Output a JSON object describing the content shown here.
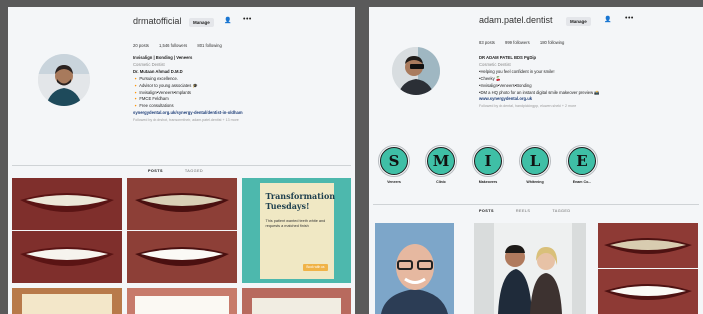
{
  "left_profile": {
    "username": "drmatofficial",
    "manage_button": "Manage",
    "more_button": "•••",
    "stats": {
      "posts": "20 posts",
      "followers": "1,546 followers",
      "following": "801 following"
    },
    "bio": [
      "Invisalign | Bonding | Veneers",
      "Cosmetic Dentist",
      "Dr. Mutaan Ahmad D.M.D",
      "🔸 Pursuing excellence.",
      "🔸 Advisor to young associates 🎓",
      "🔸 Invisalign•Veneers•Implants",
      "🔸 FMCE Feldham",
      "🔸 Free consultations",
      "synergydental.org.uk/synergy-dental/dentist-in-oldham",
      "Followed by dr.drshot, transormtheir, adam.patel.dentist + 13 more"
    ],
    "tabs": [
      "POSTS",
      "TAGGED"
    ],
    "transformation_card": {
      "title": "Transformation Tuesdays!",
      "body": "This patient wanted teeth white and requests a matched finish",
      "button": "Book with us"
    }
  },
  "right_profile": {
    "username": "adam.patel.dentist",
    "manage_button": "Manage",
    "more_button": "•••",
    "stats": {
      "posts": "83 posts",
      "followers": "999 followers",
      "following": "180 following"
    },
    "bio": [
      "DR ADAM PATEL BDS PgDip",
      "Cosmetic Dentist",
      "•Helping you feel confident in your smile!",
      "•Cheeky 🍒",
      "•Invisalign•Veneers•Bonding",
      "•DM a HQ photo for an instant digital smile makeover preview 📸",
      "www.synergydental.org.uk",
      "Followed by dr.dental, handpickingpp, eluwen.sheki + 2 more"
    ],
    "highlights": [
      {
        "letter": "S",
        "label": "Veneers"
      },
      {
        "letter": "M",
        "label": "Clinic"
      },
      {
        "letter": "I",
        "label": "Makeovers"
      },
      {
        "letter": "L",
        "label": "Whitening"
      },
      {
        "letter": "E",
        "label": "Enam Co..."
      }
    ],
    "tabs": [
      "POSTS",
      "REELS",
      "TAGGED"
    ]
  },
  "colors": {
    "background": "#5a5a5a",
    "panel": "#f4f6f8",
    "highlight_fill": "#3fbfa6",
    "link": "#1f3f79"
  }
}
